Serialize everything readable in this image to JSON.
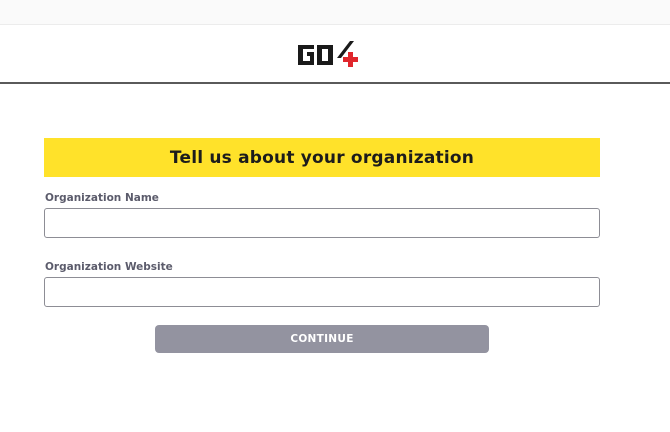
{
  "header": {
    "logo": {
      "icon": "go4-logo",
      "text": "GO4",
      "colors": {
        "letters": "#1a1a1a",
        "plus": "#e0262c"
      }
    }
  },
  "form": {
    "title": "Tell us about your organization",
    "banner_color": "#ffe22a",
    "fields": [
      {
        "label": "Organization Name",
        "value": "",
        "placeholder": ""
      },
      {
        "label": "Organization Website",
        "value": "",
        "placeholder": ""
      }
    ],
    "continue_label": "CONTINUE",
    "continue_color": "#9393a0"
  }
}
